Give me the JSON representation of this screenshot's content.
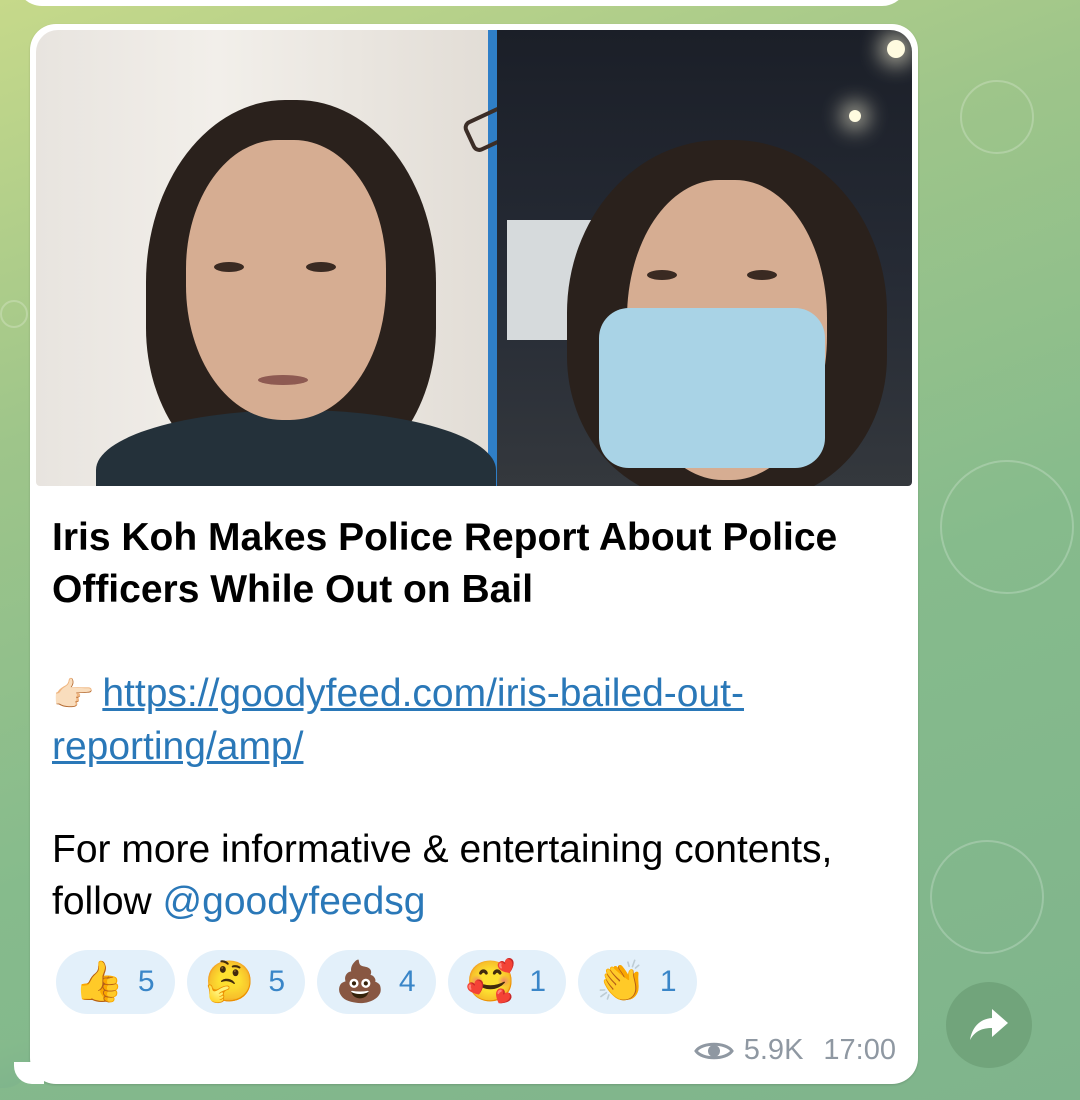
{
  "post": {
    "title": "Iris Koh Makes Police Report About Police Officers While Out on Bail",
    "pointer_emoji": "👉🏻",
    "link": "https://goodyfeed.com/iris-bailed-out-reporting/amp/",
    "follow_text": "For more informative & entertaining contents, follow ",
    "mention": "@goodyfeedsg"
  },
  "reactions": [
    {
      "emoji": "👍",
      "count": "5"
    },
    {
      "emoji": "🤔",
      "count": "5"
    },
    {
      "emoji": "💩",
      "count": "4"
    },
    {
      "emoji": "🥰",
      "count": "1"
    },
    {
      "emoji": "👏",
      "count": "1"
    }
  ],
  "meta": {
    "views": "5.9K",
    "time": "17:00"
  },
  "icons": {
    "views": "eye-icon",
    "share": "share-arrow-icon"
  }
}
